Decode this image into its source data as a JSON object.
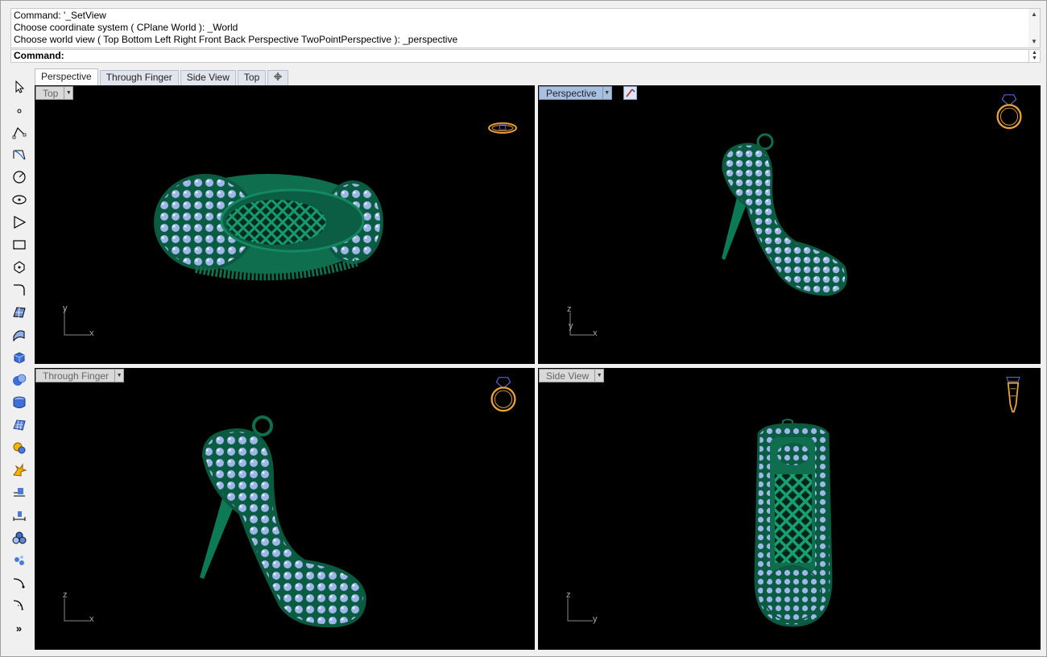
{
  "command": {
    "history": [
      "Command: '_SetView",
      "Choose coordinate system ( CPlane  World ): _World",
      "Choose world view ( Top  Bottom  Left  Right  Front  Back  Perspective  TwoPointPerspective ): _perspective"
    ],
    "prompt_label": "Command:"
  },
  "tabs": [
    {
      "label": "Perspective",
      "active": true
    },
    {
      "label": "Through Finger",
      "active": false
    },
    {
      "label": "Side View",
      "active": false
    },
    {
      "label": "Top",
      "active": false
    },
    {
      "label": "+",
      "icon": "add-tab-icon"
    }
  ],
  "toolbar": {
    "tools": [
      "select-arrow-icon",
      "point-icon",
      "polyline-icon",
      "curve-control-points-icon",
      "circle-icon",
      "ellipse-icon",
      "polygon-icon",
      "rectangle-icon",
      "polygon-star-icon",
      "fillet-curve-icon",
      "surface-from-points-icon",
      "surface-edit-icon",
      "box-solid-icon",
      "boolean-union-icon",
      "cylinder-icon",
      "mesh-icon",
      "transform-icon",
      "explode-icon",
      "analyze-icon",
      "dimension-icon",
      "render-spheres-icon",
      "group-icon",
      "curve-tool-icon",
      "curve-fillet-icon"
    ],
    "more_label": "»"
  },
  "viewports": {
    "top": {
      "name": "Top",
      "axes": [
        "y",
        "x"
      ]
    },
    "perspective": {
      "name": "Perspective",
      "axes": [
        "z",
        "y",
        "x"
      ]
    },
    "through_finger": {
      "name": "Through Finger",
      "axes": [
        "z",
        "x"
      ]
    },
    "side_view": {
      "name": "Side View",
      "axes": [
        "z",
        "y"
      ]
    }
  },
  "colors": {
    "viewport_bg": "#000000",
    "model_green": "#0e6e4e",
    "gem_blue": "#9eb6e8",
    "nav_orange": "#e8a23a",
    "active_label": "#a8c0dd"
  }
}
